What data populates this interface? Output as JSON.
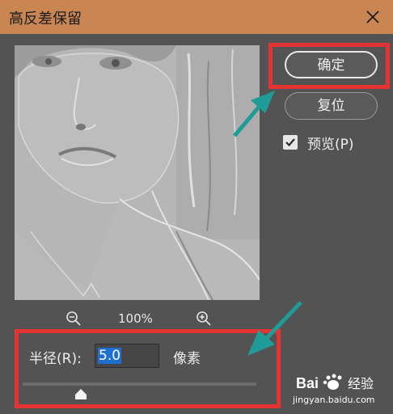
{
  "window": {
    "title": "高反差保留"
  },
  "buttons": {
    "ok_label": "确定",
    "reset_label": "复位"
  },
  "preview_option": {
    "label": "预览(P)",
    "checked": true
  },
  "zoom": {
    "level": "100%"
  },
  "radius": {
    "label": "半径(R):",
    "value": "5.0",
    "unit": "像素",
    "slider_fraction": 0.25
  },
  "watermark": {
    "brand": "Bai 经验",
    "url": "jingyan.baidu.com"
  },
  "colors": {
    "title_bar": "#c98653",
    "dialog_bg": "#535353",
    "highlight": "#e53333",
    "arrow": "#1f9c98",
    "selection": "#1f6fd0"
  }
}
